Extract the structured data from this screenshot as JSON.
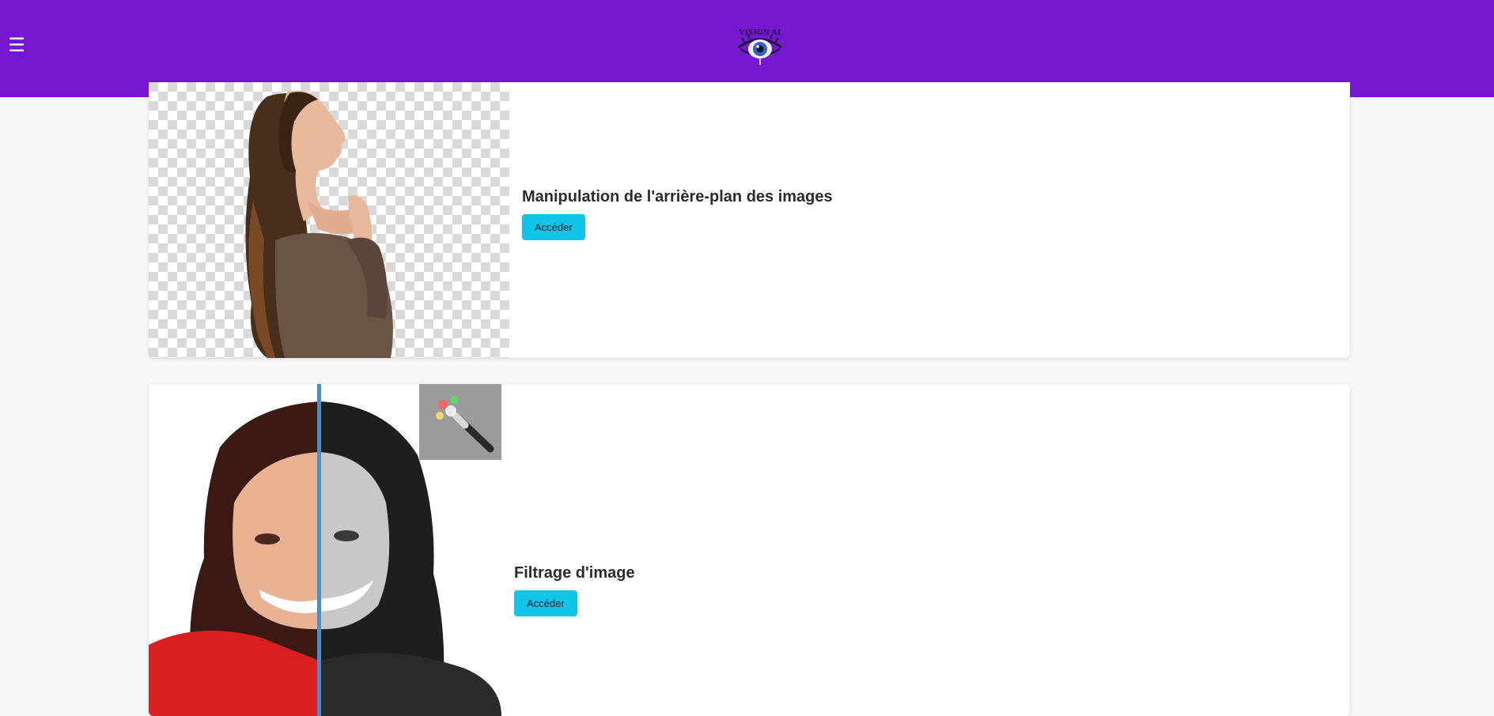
{
  "header": {
    "menu_icon": "hamburger-icon",
    "menu_glyph": "☰",
    "logo_text": "VISION AI",
    "background_color": "#7518d0"
  },
  "cards": [
    {
      "title": "Manipulation de l'arrière-plan des images",
      "button_label": "Accéder",
      "image": "woman-profile-transparent-background"
    },
    {
      "title": "Filtrage d'image",
      "button_label": "Accéder",
      "image": "woman-face-color-grayscale-split"
    }
  ],
  "colors": {
    "accent_button": "#11c4e8",
    "page_background": "#f6f7f9"
  }
}
